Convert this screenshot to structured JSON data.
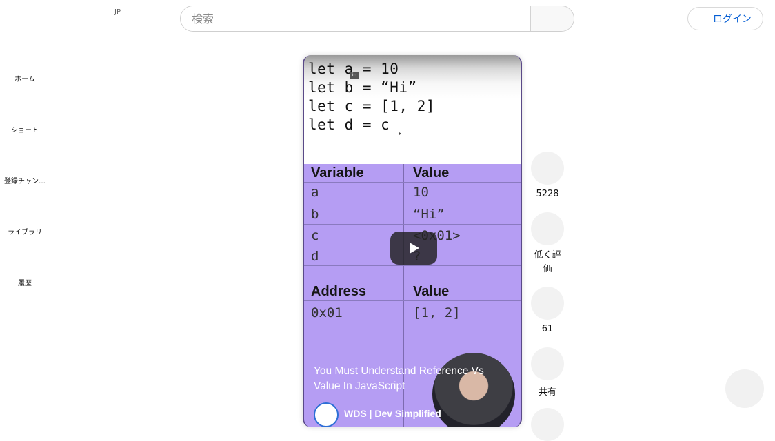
{
  "header": {
    "country_code": "JP",
    "search_placeholder": "検索",
    "login_label": "ログイン"
  },
  "sidebar": {
    "items": [
      {
        "label": "ホーム"
      },
      {
        "label": "ショート"
      },
      {
        "label": "登録チャン…"
      },
      {
        "label": "ライブラリ"
      },
      {
        "label": "履歴"
      }
    ]
  },
  "video": {
    "code_lines": [
      "let a = 10",
      "let b = “Hi”",
      "let c = [1, 2]",
      "let d = c"
    ],
    "badge": "in",
    "variable_table": {
      "headers": [
        "Variable",
        "Value"
      ],
      "rows": [
        [
          "a",
          "10"
        ],
        [
          "b",
          "“Hi”"
        ],
        [
          "c",
          "<0x01>"
        ],
        [
          "d",
          "?"
        ]
      ]
    },
    "address_table": {
      "headers": [
        "Address",
        "Value"
      ],
      "rows": [
        [
          "0x01",
          "[1, 2]"
        ]
      ]
    },
    "title": "You Must Understand Reference Vs Value In JavaScript",
    "channel_name": "WDS | Dev Simplified"
  },
  "actions": {
    "like_count": "5228",
    "dislike_label": "低く評価",
    "comment_count": "61",
    "share_label": "共有"
  }
}
